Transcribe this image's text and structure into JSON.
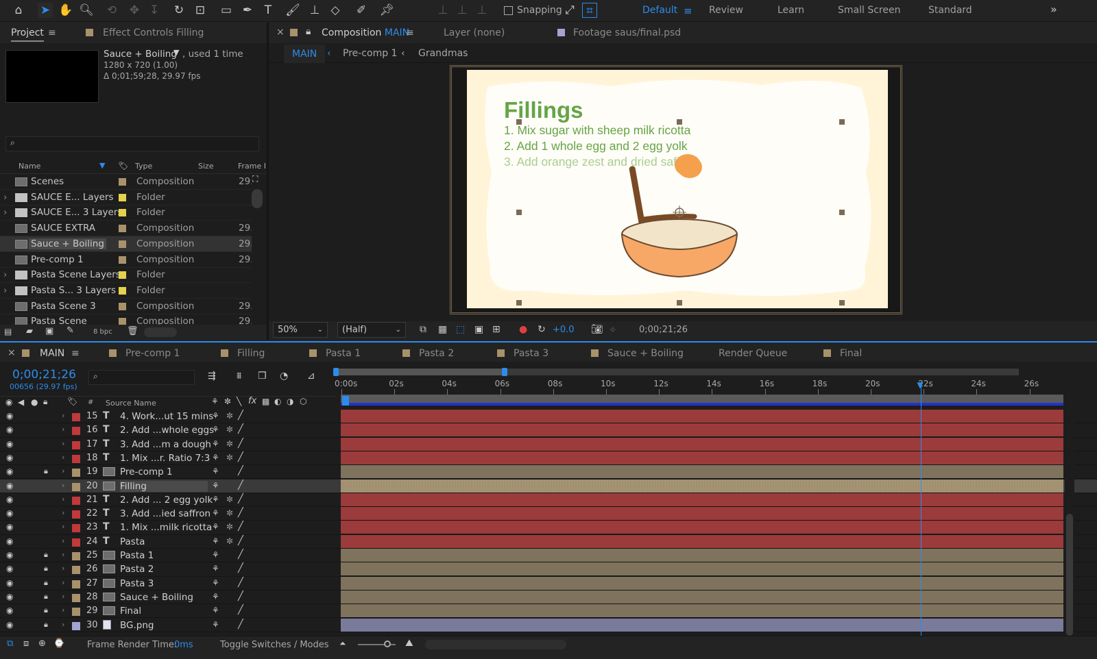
{
  "toolbar": {
    "snapping_label": "Snapping",
    "workspaces": [
      "Default",
      "Review",
      "Learn",
      "Small Screen",
      "Standard"
    ],
    "active_workspace": "Default",
    "more": "»"
  },
  "project_panel": {
    "tab_project": "Project",
    "tab_effect_controls": "Effect Controls Filling",
    "selected_item_name": "Sauce + Boiling",
    "used_text": ", used 1 time",
    "resolution": "1280 x 720 (1.00)",
    "duration": "Δ 0;01;59;28, 29.97 fps",
    "search_placeholder": "",
    "columns": {
      "name": "Name",
      "type": "Type",
      "size": "Size",
      "frame_rate": "Frame R"
    },
    "items": [
      {
        "name": "Scenes",
        "type": "Composition",
        "frame_rate": "29.",
        "kind": "comp",
        "label_color": "#a9926b"
      },
      {
        "name": "SAUCE E... Layers",
        "type": "Folder",
        "frame_rate": "",
        "kind": "folder",
        "label_color": "#e3d24d"
      },
      {
        "name": "SAUCE E... 3 Layers",
        "type": "Folder",
        "frame_rate": "",
        "kind": "folder",
        "label_color": "#e3d24d"
      },
      {
        "name": "SAUCE EXTRA",
        "type": "Composition",
        "frame_rate": "29.",
        "kind": "comp",
        "label_color": "#a9926b"
      },
      {
        "name": "Sauce + Boiling",
        "type": "Composition",
        "frame_rate": "29.",
        "kind": "comp",
        "label_color": "#a9926b",
        "selected": true
      },
      {
        "name": "Pre-comp 1",
        "type": "Composition",
        "frame_rate": "29.",
        "kind": "comp",
        "label_color": "#a9926b"
      },
      {
        "name": "Pasta Scene Layers",
        "type": "Folder",
        "frame_rate": "",
        "kind": "folder",
        "label_color": "#e3d24d"
      },
      {
        "name": "Pasta S... 3 Layers",
        "type": "Folder",
        "frame_rate": "",
        "kind": "folder",
        "label_color": "#e3d24d"
      },
      {
        "name": "Pasta Scene 3",
        "type": "Composition",
        "frame_rate": "29.",
        "kind": "comp",
        "label_color": "#a9926b"
      },
      {
        "name": "Pasta Scene",
        "type": "Composition",
        "frame_rate": "29.",
        "kind": "comp",
        "label_color": "#a9926b"
      }
    ],
    "bpc": "8 bpc"
  },
  "composition_panel": {
    "tab_label": "Composition",
    "tab_comp_name": "MAIN",
    "tab_layer": "Layer (none)",
    "tab_footage": "Footage saus/final.psd",
    "breadcrumbs": [
      "MAIN",
      "Pre-comp 1",
      "Grandmas"
    ],
    "canvas": {
      "title": "Fillings",
      "line1": "1. Mix sugar with sheep milk ricotta",
      "line2": "2. Add 1 whole egg and 2 egg yolk",
      "line3": "3. Add orange zest and dried saffron"
    },
    "zoom": "50%",
    "resolution": "(Half)",
    "exposure": "+0.0",
    "timecode": "0;00;21;26"
  },
  "timeline": {
    "tabs": [
      {
        "label": "MAIN",
        "active": true,
        "color": "#a9926b"
      },
      {
        "label": "Pre-comp 1",
        "color": "#a9926b"
      },
      {
        "label": "Filling",
        "color": "#a9926b"
      },
      {
        "label": "Pasta 1",
        "color": "#a9926b"
      },
      {
        "label": "Pasta 2",
        "color": "#a9926b"
      },
      {
        "label": "Pasta 3",
        "color": "#a9926b"
      },
      {
        "label": "Sauce + Boiling",
        "color": "#a9926b"
      },
      {
        "label": "Render Queue",
        "color": ""
      },
      {
        "label": "Final",
        "color": "#a9926b"
      }
    ],
    "current_time": "0;00;21;26",
    "frame_info": "00656 (29.97 fps)",
    "columns": {
      "hash": "#",
      "source_name": "Source Name"
    },
    "ruler": [
      "0:00s",
      "02s",
      "04s",
      "06s",
      "08s",
      "10s",
      "12s",
      "14s",
      "16s",
      "18s",
      "20s",
      "22s",
      "24s",
      "26s"
    ],
    "playhead_seconds": 21.9,
    "layers": [
      {
        "num": "15",
        "kind": "T",
        "name": "4. Work...ut 15 mins",
        "label_color": "#c0393b",
        "locked": false,
        "bar_color": "#9b3b3b"
      },
      {
        "num": "16",
        "kind": "T",
        "name": "2. Add ...whole eggs",
        "label_color": "#c0393b",
        "locked": false,
        "bar_color": "#9b3b3b"
      },
      {
        "num": "17",
        "kind": "T",
        "name": "3. Add ...m a dough",
        "label_color": "#c0393b",
        "locked": false,
        "bar_color": "#9b3b3b"
      },
      {
        "num": "18",
        "kind": "T",
        "name": "1. Mix ...r. Ratio 7:3",
        "label_color": "#c0393b",
        "locked": false,
        "bar_color": "#9b3b3b"
      },
      {
        "num": "19",
        "kind": "comp",
        "name": "Pre-comp 1",
        "label_color": "#a9926b",
        "locked": true,
        "bar_color": "#7f735e"
      },
      {
        "num": "20",
        "kind": "comp",
        "name": "Filling",
        "label_color": "#a9926b",
        "locked": false,
        "bar_color": "#a09070",
        "selected": true
      },
      {
        "num": "21",
        "kind": "T",
        "name": "2. Add ... 2 egg yolk",
        "label_color": "#c0393b",
        "locked": false,
        "bar_color": "#9b3b3b"
      },
      {
        "num": "22",
        "kind": "T",
        "name": "3. Add ...ied saffron",
        "label_color": "#c0393b",
        "locked": false,
        "bar_color": "#9b3b3b"
      },
      {
        "num": "23",
        "kind": "T",
        "name": "1. Mix ...milk ricotta",
        "label_color": "#c0393b",
        "locked": false,
        "bar_color": "#9b3b3b"
      },
      {
        "num": "24",
        "kind": "T",
        "name": "Pasta",
        "label_color": "#c0393b",
        "locked": false,
        "bar_color": "#9b3b3b"
      },
      {
        "num": "25",
        "kind": "comp",
        "name": "Pasta 1",
        "label_color": "#a9926b",
        "locked": true,
        "bar_color": "#7f735e"
      },
      {
        "num": "26",
        "kind": "comp",
        "name": "Pasta 2",
        "label_color": "#a9926b",
        "locked": true,
        "bar_color": "#7f735e"
      },
      {
        "num": "27",
        "kind": "comp",
        "name": "Pasta 3",
        "label_color": "#a9926b",
        "locked": true,
        "bar_color": "#7f735e"
      },
      {
        "num": "28",
        "kind": "comp",
        "name": "Sauce + Boiling",
        "label_color": "#a9926b",
        "locked": true,
        "bar_color": "#7f735e"
      },
      {
        "num": "29",
        "kind": "comp",
        "name": "Final",
        "label_color": "#a9926b",
        "locked": true,
        "bar_color": "#7f735e"
      },
      {
        "num": "30",
        "kind": "footage",
        "name": "BG.png",
        "label_color": "#a4a4d4",
        "locked": true,
        "bar_color": "#7a7a9a"
      }
    ],
    "frame_render_label": "Frame Render Time:",
    "frame_render_value": "0ms",
    "toggle_label": "Toggle Switches / Modes"
  }
}
